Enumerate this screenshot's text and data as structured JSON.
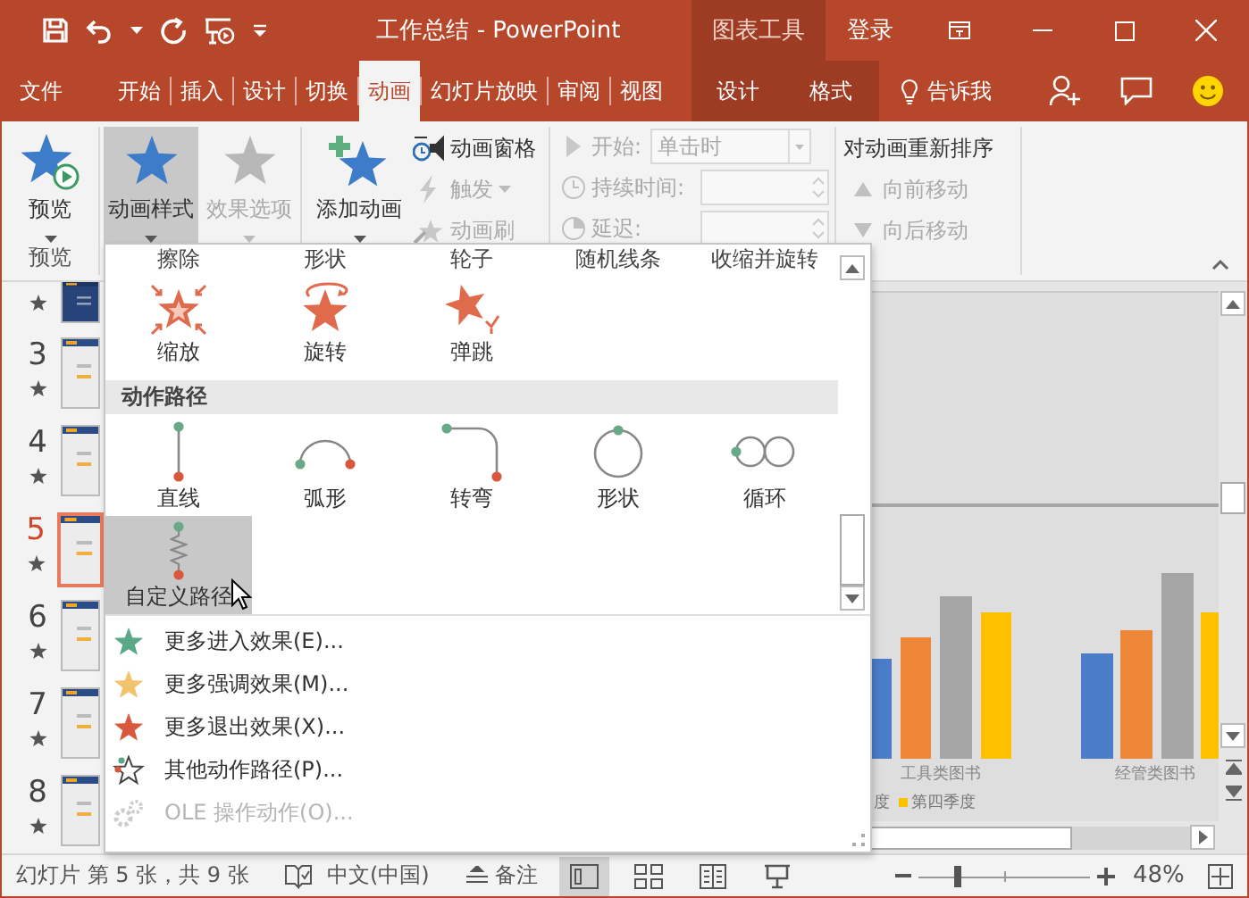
{
  "title_bar": {
    "title": "工作总结 - PowerPoint",
    "context_header": "图表工具",
    "sign_in": "登录"
  },
  "tabs": [
    {
      "label": "文件",
      "kind": "file",
      "selected": false
    },
    {
      "label": "开始",
      "kind": "normal",
      "selected": false
    },
    {
      "label": "插入",
      "kind": "normal",
      "selected": false
    },
    {
      "label": "设计",
      "kind": "normal",
      "selected": false
    },
    {
      "label": "切换",
      "kind": "normal",
      "selected": false
    },
    {
      "label": "动画",
      "kind": "normal",
      "selected": true
    },
    {
      "label": "幻灯片放映",
      "kind": "normal",
      "selected": false
    },
    {
      "label": "审阅",
      "kind": "normal",
      "selected": false
    },
    {
      "label": "视图",
      "kind": "normal",
      "selected": false
    },
    {
      "label": "设计",
      "kind": "context",
      "selected": false
    },
    {
      "label": "格式",
      "kind": "context",
      "selected": false
    }
  ],
  "tell_me": "告诉我",
  "ribbon": {
    "preview": {
      "label": "预览",
      "group_label": "预览"
    },
    "animation_buttons": [
      {
        "label": "动画样式",
        "selected": true,
        "disabled": false
      },
      {
        "label": "效果选项",
        "selected": false,
        "disabled": true
      }
    ],
    "add_animation": {
      "label": "添加动画"
    },
    "small_buttons": [
      {
        "label": "动画窗格",
        "kind": "pane",
        "disabled": false
      },
      {
        "label": "触发",
        "kind": "trigger",
        "disabled": true
      },
      {
        "label": "动画刷",
        "kind": "painter",
        "disabled": true
      }
    ],
    "timing": [
      {
        "label": "开始:",
        "kind": "start",
        "value": "单击时",
        "disabled": true
      },
      {
        "label": "持续时间:",
        "kind": "duration",
        "disabled": true
      },
      {
        "label": "延迟:",
        "kind": "delay",
        "disabled": true
      }
    ],
    "reorder": {
      "title": "对动画重新排序",
      "buttons": [
        {
          "label": "向前移动",
          "kind": "up",
          "disabled": true
        },
        {
          "label": "向后移动",
          "kind": "down",
          "disabled": true
        }
      ]
    }
  },
  "slides": [
    {
      "kind": "dark",
      "selected": false
    },
    {
      "number": "3",
      "kind": "light",
      "selected": false
    },
    {
      "number": "4",
      "kind": "light",
      "selected": false
    },
    {
      "number": "5",
      "kind": "light",
      "selected": true
    },
    {
      "number": "6",
      "kind": "light",
      "selected": false
    },
    {
      "number": "7",
      "kind": "light",
      "selected": false
    },
    {
      "number": "8",
      "kind": "light",
      "selected": false
    }
  ],
  "gallery": {
    "top_row": [
      "擦除",
      "形状",
      "轮子",
      "随机线条",
      "收缩并旋转"
    ],
    "effects": [
      {
        "label": "缩放",
        "kind": "zoom"
      },
      {
        "label": "旋转",
        "kind": "spin"
      },
      {
        "label": "弹跳",
        "kind": "bounce"
      }
    ],
    "section_title": "动作路径",
    "paths": [
      {
        "label": "直线",
        "kind": "line",
        "selected": false
      },
      {
        "label": "弧形",
        "kind": "arc",
        "selected": false
      },
      {
        "label": "转弯",
        "kind": "turn",
        "selected": false
      },
      {
        "label": "形状",
        "kind": "circle",
        "selected": false
      },
      {
        "label": "循环",
        "kind": "loop",
        "selected": false
      },
      {
        "label": "自定义路径",
        "kind": "custom",
        "selected": true
      }
    ],
    "menu": [
      {
        "label": "更多进入效果(E)...",
        "kind": "entrance",
        "disabled": false
      },
      {
        "label": "更多强调效果(M)...",
        "kind": "emphasis",
        "disabled": false
      },
      {
        "label": "更多退出效果(X)...",
        "kind": "exit",
        "disabled": false
      },
      {
        "label": "其他动作路径(P)...",
        "kind": "path",
        "disabled": false
      },
      {
        "label": "OLE 操作动作(O)...",
        "kind": "ole",
        "disabled": true
      }
    ]
  },
  "slide_view": {
    "categories": [
      "工具类图书",
      "经管类图书"
    ],
    "legend": [
      {
        "label": "度"
      },
      {
        "label": "第四季度",
        "color": "#ffc000"
      }
    ]
  },
  "status_bar": {
    "slide_info": "幻灯片 第 5 张，共 9 张",
    "language": "中文(中国)",
    "notes": "备注",
    "views": [
      {
        "kind": "normal",
        "selected": true
      },
      {
        "kind": "sorter",
        "selected": false
      },
      {
        "kind": "reading",
        "selected": false
      },
      {
        "kind": "slideshow",
        "selected": false
      }
    ],
    "zoom": {
      "level": 0.23,
      "percent": "48%"
    }
  }
}
